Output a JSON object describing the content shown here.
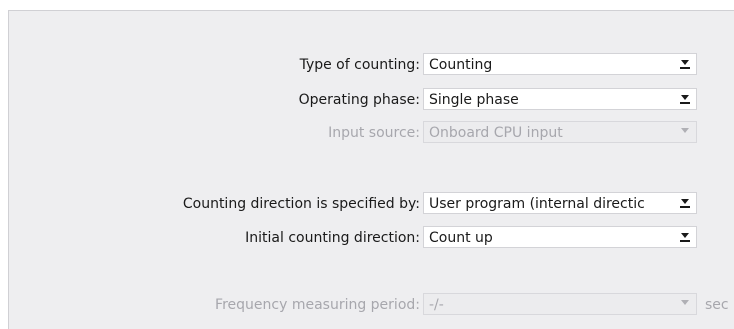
{
  "fields": [
    {
      "label": "Type of counting:",
      "value": "Counting",
      "enabled": true
    },
    {
      "label": "Operating phase:",
      "value": "Single phase",
      "enabled": true
    },
    {
      "label": "Input source:",
      "value": "Onboard CPU input",
      "enabled": false
    },
    {
      "label": "Counting direction is specified by:",
      "value": "User program (internal directic",
      "enabled": true
    },
    {
      "label": "Initial counting direction:",
      "value": "Count up",
      "enabled": true
    },
    {
      "label": "Frequency measuring period:",
      "value": "-/-",
      "enabled": false,
      "unit": "sec"
    }
  ],
  "colors": {
    "panel_background": "#eeeef0",
    "disabled_text": "#a7a7ad",
    "field_background": "#ffffff"
  }
}
